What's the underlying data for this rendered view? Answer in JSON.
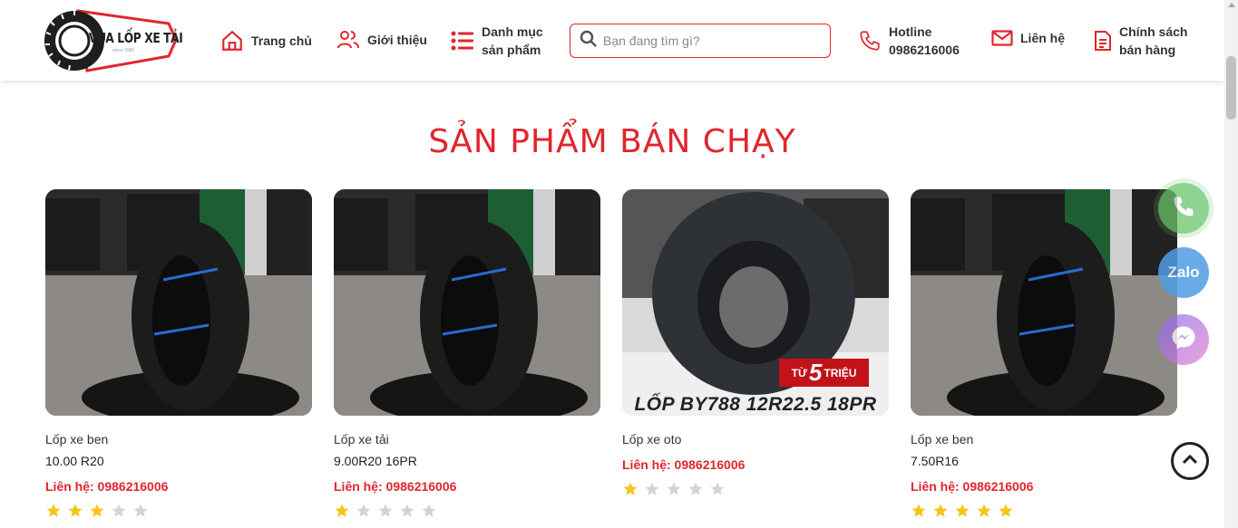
{
  "header": {
    "logo_text": "VUA LỐP XE TẢI",
    "logo_sub": "since 1990",
    "nav": {
      "home": "Trang chủ",
      "about": "Giới thiệu",
      "category_line1": "Danh mục",
      "category_line2": "sản phẩm",
      "hotline_label": "Hotline",
      "hotline_number": "0986216006",
      "contact": "Liên hệ",
      "policy_line1": "Chính sách",
      "policy_line2": "bán hàng"
    },
    "search": {
      "placeholder": "Bạn đang tìm gì?",
      "value": ""
    }
  },
  "section": {
    "title": "SẢN PHẨM BÁN CHẠY"
  },
  "products": [
    {
      "name": "Lốp xe ben",
      "size": "10.00 R20",
      "contact": "Liên hệ: 0986216006",
      "rating": 3
    },
    {
      "name": "Lốp xe tải",
      "size": "9.00R20 16PR",
      "contact": "Liên hệ: 0986216006",
      "rating": 1
    },
    {
      "name": "Lốp xe oto",
      "size": "",
      "contact": "Liên hệ: 0986216006",
      "rating": 1,
      "promo_prefix": "TỪ",
      "promo_number": "5",
      "promo_suffix": "TRIỆU",
      "promo_caption": "LỐP BY788 12R22.5 18PR"
    },
    {
      "name": "Lốp xe ben",
      "size": "7.50R16",
      "contact": "Liên hệ: 0986216006",
      "rating": 5
    }
  ],
  "floating": {
    "zalo_label": "Zalo"
  },
  "colors": {
    "accent": "#e0262e",
    "star_on": "#f5c518",
    "star_off": "#d4d4d4"
  }
}
